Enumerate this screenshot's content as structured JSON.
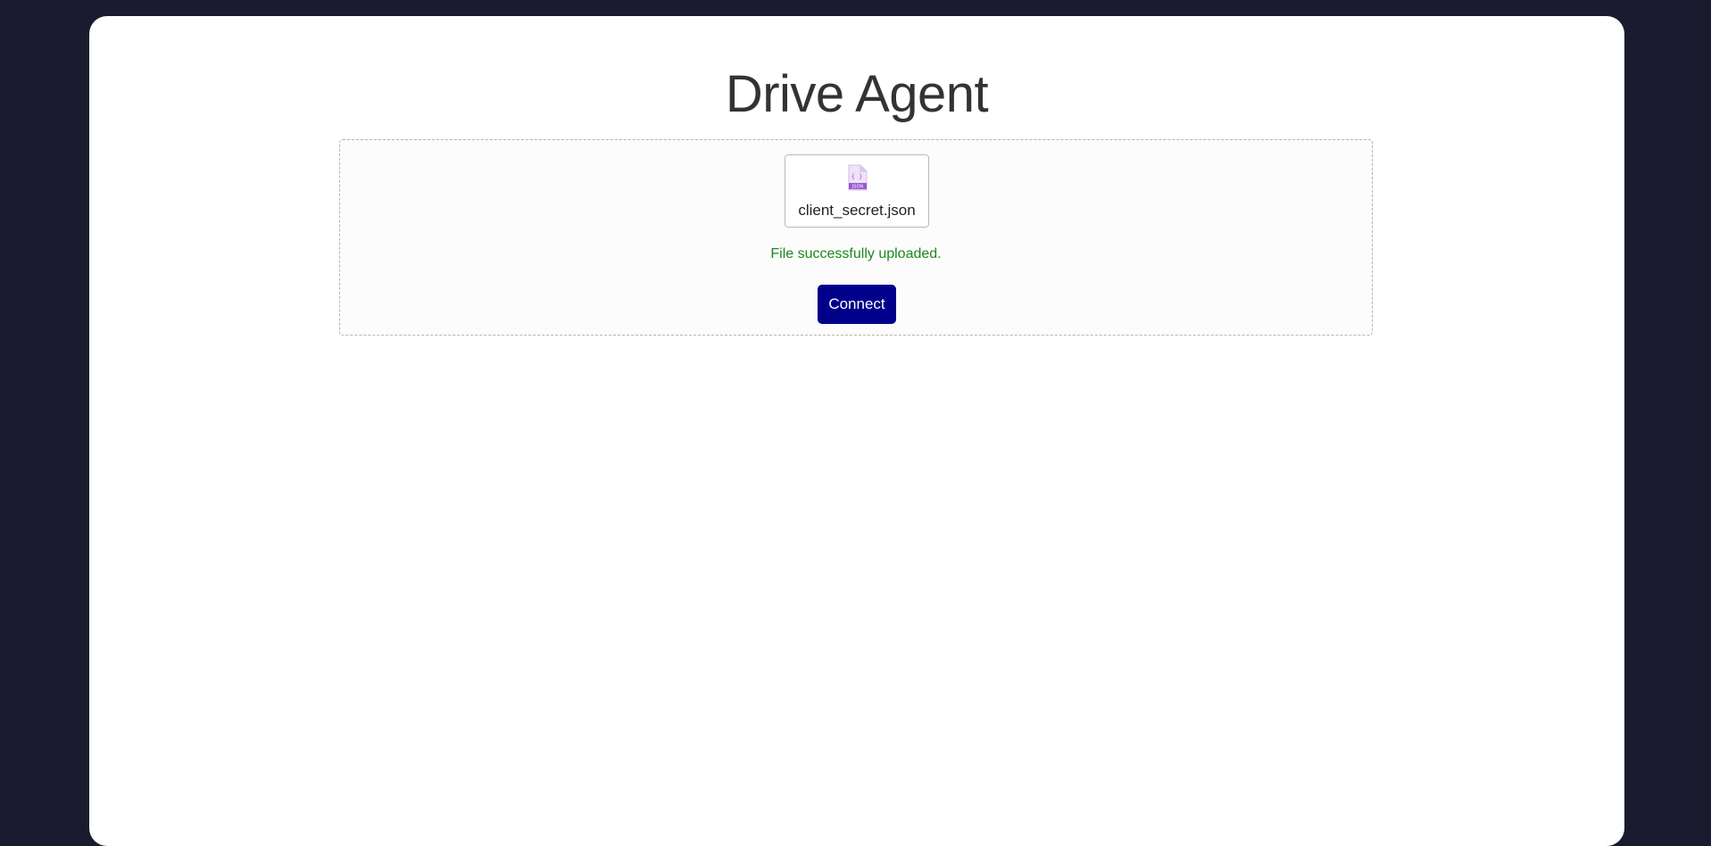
{
  "app": {
    "title": "Drive Agent"
  },
  "upload": {
    "file": {
      "name": "client_secret.json",
      "icon": "json-file-icon",
      "icon_badge": "JSON",
      "icon_glyph": "{ }"
    },
    "status": "File successfully uploaded.",
    "connect_label": "Connect"
  },
  "colors": {
    "background": "#1b1b2f",
    "card": "#ffffff",
    "title": "#333333",
    "success": "#1a8a1a",
    "button": "#00008b",
    "file_icon": "#9b59d0"
  }
}
